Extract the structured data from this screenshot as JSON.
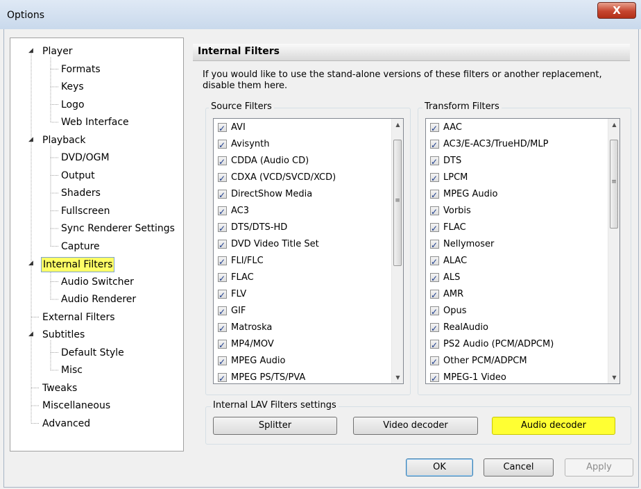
{
  "window": {
    "title": "Options",
    "close_glyph": "X"
  },
  "tree": {
    "nodes": [
      {
        "label": "Player",
        "expander": "◢",
        "selected": false
      },
      {
        "label": "Formats"
      },
      {
        "label": "Keys"
      },
      {
        "label": "Logo"
      },
      {
        "label": "Web Interface"
      },
      {
        "label": "Playback",
        "expander": "◢"
      },
      {
        "label": "DVD/OGM"
      },
      {
        "label": "Output"
      },
      {
        "label": "Shaders"
      },
      {
        "label": "Fullscreen"
      },
      {
        "label": "Sync Renderer Settings"
      },
      {
        "label": "Capture"
      },
      {
        "label": "Internal Filters",
        "expander": "◢",
        "selected": true
      },
      {
        "label": "Audio Switcher"
      },
      {
        "label": "Audio Renderer"
      },
      {
        "label": "External Filters"
      },
      {
        "label": "Subtitles",
        "expander": "◢"
      },
      {
        "label": "Default Style"
      },
      {
        "label": "Misc"
      },
      {
        "label": "Tweaks"
      },
      {
        "label": "Miscellaneous"
      },
      {
        "label": "Advanced"
      }
    ]
  },
  "panel": {
    "title": "Internal Filters",
    "description": "If you would like to use the stand-alone versions of these filters or another replacement, disable them here."
  },
  "source_filters": {
    "label": "Source Filters",
    "items": [
      {
        "label": "AVI",
        "checked": true
      },
      {
        "label": "Avisynth",
        "checked": true
      },
      {
        "label": "CDDA (Audio CD)",
        "checked": true
      },
      {
        "label": "CDXA (VCD/SVCD/XCD)",
        "checked": true
      },
      {
        "label": "DirectShow Media",
        "checked": true
      },
      {
        "label": "AC3",
        "checked": true
      },
      {
        "label": "DTS/DTS-HD",
        "checked": true
      },
      {
        "label": "DVD Video Title Set",
        "checked": true
      },
      {
        "label": "FLI/FLC",
        "checked": true
      },
      {
        "label": "FLAC",
        "checked": true
      },
      {
        "label": "FLV",
        "checked": true
      },
      {
        "label": "GIF",
        "checked": true
      },
      {
        "label": "Matroska",
        "checked": true
      },
      {
        "label": "MP4/MOV",
        "checked": true
      },
      {
        "label": "MPEG Audio",
        "checked": true
      },
      {
        "label": "MPEG PS/TS/PVA",
        "checked": true
      }
    ]
  },
  "transform_filters": {
    "label": "Transform Filters",
    "items": [
      {
        "label": "AAC",
        "checked": true
      },
      {
        "label": "AC3/E-AC3/TrueHD/MLP",
        "checked": true
      },
      {
        "label": "DTS",
        "checked": true
      },
      {
        "label": "LPCM",
        "checked": true
      },
      {
        "label": "MPEG Audio",
        "checked": true
      },
      {
        "label": "Vorbis",
        "checked": true
      },
      {
        "label": "FLAC",
        "checked": true
      },
      {
        "label": "Nellymoser",
        "checked": true
      },
      {
        "label": "ALAC",
        "checked": true
      },
      {
        "label": "ALS",
        "checked": true
      },
      {
        "label": "AMR",
        "checked": true
      },
      {
        "label": "Opus",
        "checked": true
      },
      {
        "label": "RealAudio",
        "checked": true
      },
      {
        "label": "PS2 Audio (PCM/ADPCM)",
        "checked": true
      },
      {
        "label": "Other PCM/ADPCM",
        "checked": true
      },
      {
        "label": "MPEG-1 Video",
        "checked": true
      }
    ]
  },
  "lav": {
    "label": "Internal LAV Filters settings",
    "splitter": "Splitter",
    "video_decoder": "Video decoder",
    "audio_decoder": "Audio decoder"
  },
  "footer": {
    "ok": "OK",
    "cancel": "Cancel",
    "apply": "Apply"
  },
  "colors": {
    "highlight": "#ffff33",
    "selection_border": "#7da2ce",
    "check": "#1c3c8c"
  },
  "icons": {
    "expander": "collapse-triangle-icon",
    "scroll_up": "▲",
    "scroll_down": "▼",
    "grip": "≡"
  }
}
